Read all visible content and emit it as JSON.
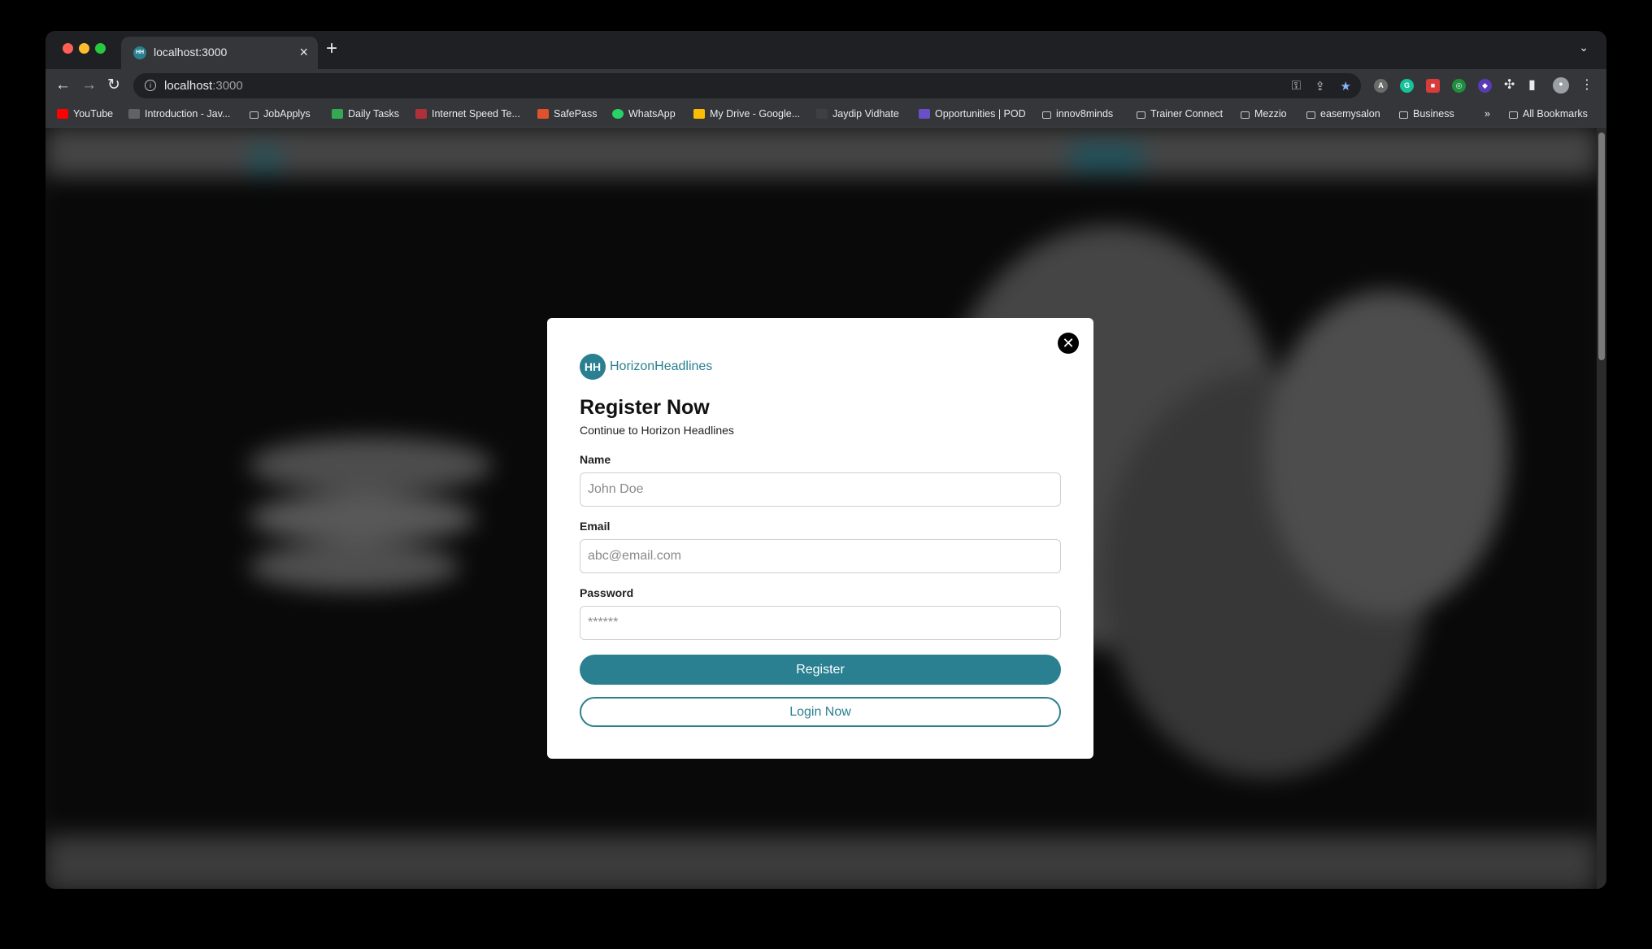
{
  "browser": {
    "tab": {
      "title": "localhost:3000",
      "favicon_text": "HH"
    },
    "new_tab_label": "+",
    "address": {
      "host": "localhost",
      "port": ":3000"
    },
    "bookmarks": [
      {
        "label": "YouTube",
        "icon": "youtube-icon",
        "color": "#ff0000"
      },
      {
        "label": "Introduction - Jav...",
        "icon": "m-icon",
        "color": "#e8eaed"
      },
      {
        "label": "JobApplys",
        "icon": "folder-icon"
      },
      {
        "label": "Daily Tasks",
        "icon": "drive-icon",
        "color": "#34a853"
      },
      {
        "label": "Internet Speed Te...",
        "icon": "speed-icon",
        "color": "#b0303a"
      },
      {
        "label": "SafePass",
        "icon": "shield-icon",
        "color": "#e0522c"
      },
      {
        "label": "WhatsApp",
        "icon": "whatsapp-icon",
        "color": "#25d366"
      },
      {
        "label": "My Drive - Google...",
        "icon": "drive-icon",
        "color": "#fbbc04"
      },
      {
        "label": "Jaydip Vidhate",
        "icon": "jv-icon",
        "color": "#e8eaed"
      },
      {
        "label": "Opportunities | POD",
        "icon": "pod-icon",
        "color": "#6a4fc9"
      },
      {
        "label": "innov8minds",
        "icon": "folder-icon"
      },
      {
        "label": "Trainer Connect",
        "icon": "folder-icon"
      },
      {
        "label": "Mezzio",
        "icon": "folder-icon"
      },
      {
        "label": "easemysalon",
        "icon": "folder-icon"
      },
      {
        "label": "Business",
        "icon": "folder-icon"
      }
    ],
    "more_bookmarks": "»",
    "all_bookmarks": "All Bookmarks"
  },
  "modal": {
    "close_symbol": "✕",
    "brand": {
      "badge": "HH",
      "name": "HorizonHeadlines",
      "color": "#2a8091"
    },
    "title": "Register Now",
    "subtitle": "Continue to Horizon Headlines",
    "fields": {
      "name": {
        "label": "Name",
        "placeholder": "John Doe",
        "value": ""
      },
      "email": {
        "label": "Email",
        "placeholder": "abc@email.com",
        "value": ""
      },
      "password": {
        "label": "Password",
        "placeholder": "******",
        "value": ""
      }
    },
    "register_button": "Register",
    "login_button": "Login Now"
  }
}
